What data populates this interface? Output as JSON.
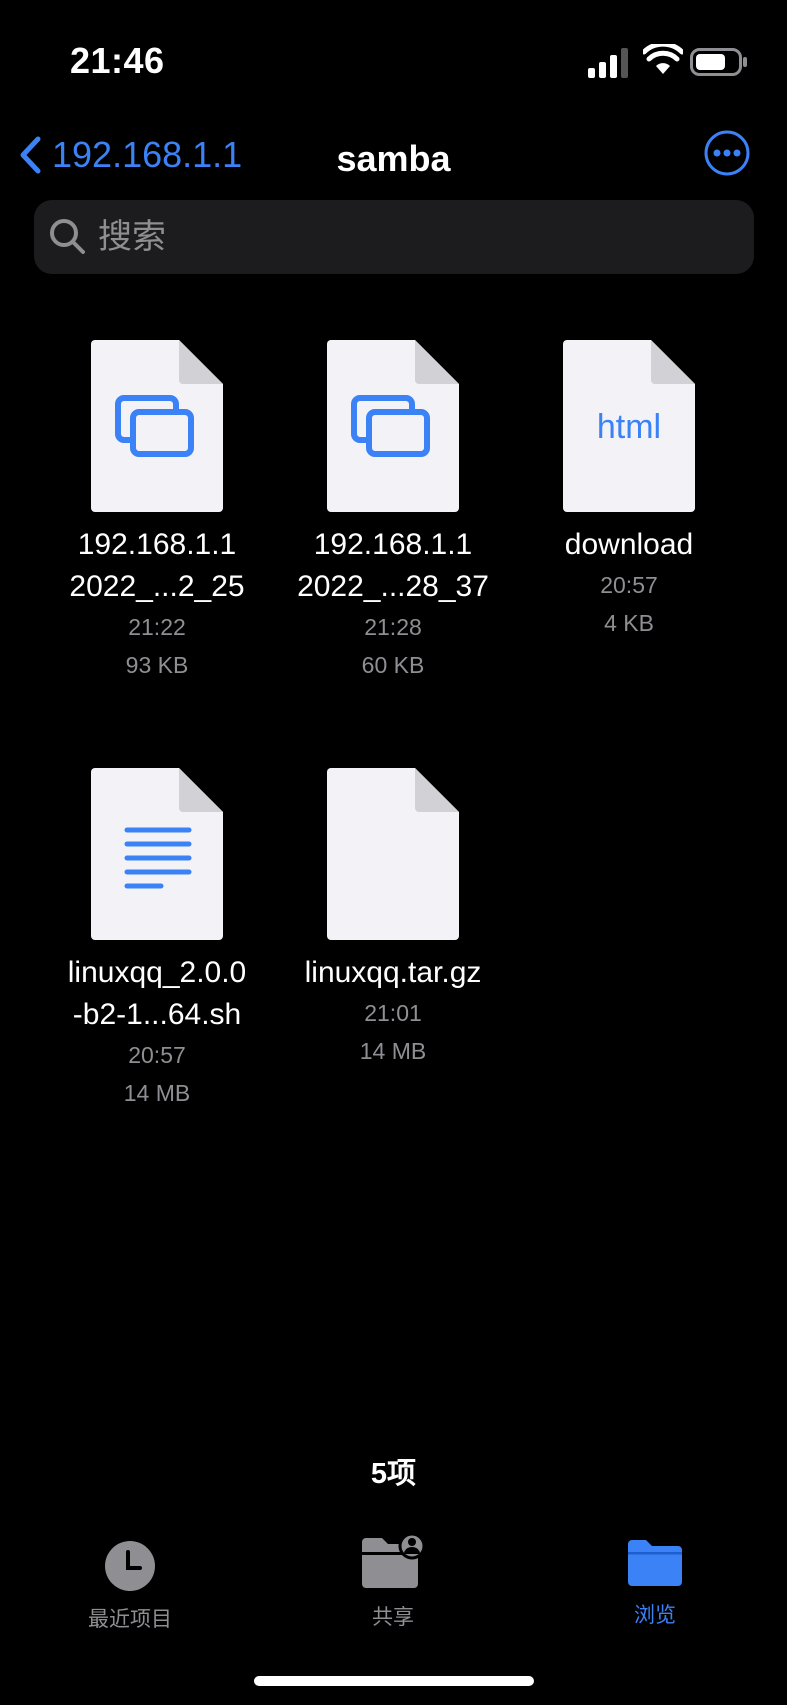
{
  "status": {
    "time": "21:46"
  },
  "nav": {
    "back_label": "192.168.1.1",
    "title": "samba"
  },
  "search": {
    "placeholder": "搜索"
  },
  "files": [
    {
      "name_line1": "192.168.1.1",
      "name_line2": "2022_...2_25",
      "time": "21:22",
      "size": "93 KB",
      "icon": "screenshot-file-icon"
    },
    {
      "name_line1": "192.168.1.1",
      "name_line2": "2022_...28_37",
      "time": "21:28",
      "size": "60 KB",
      "icon": "screenshot-file-icon"
    },
    {
      "name_line1": "download",
      "name_line2": "",
      "time": "20:57",
      "size": "4 KB",
      "icon": "html-file-icon",
      "icon_text": "html"
    },
    {
      "name_line1": "linuxqq_2.0.0",
      "name_line2": "-b2-1...64.sh",
      "time": "20:57",
      "size": "14 MB",
      "icon": "text-file-icon"
    },
    {
      "name_line1": "linuxqq.tar.gz",
      "name_line2": "",
      "time": "21:01",
      "size": "14 MB",
      "icon": "blank-file-icon"
    }
  ],
  "footer": {
    "count": "5项"
  },
  "tabs": [
    {
      "label": "最近项目",
      "icon": "clock-icon"
    },
    {
      "label": "共享",
      "icon": "shared-folder-icon"
    },
    {
      "label": "浏览",
      "icon": "folder-icon",
      "active": true
    }
  ],
  "colors": {
    "accent": "#3b82f6",
    "secondary": "#8e8e93",
    "search_bg": "#1c1c1e",
    "inactive_tab": "#8e8e93"
  }
}
